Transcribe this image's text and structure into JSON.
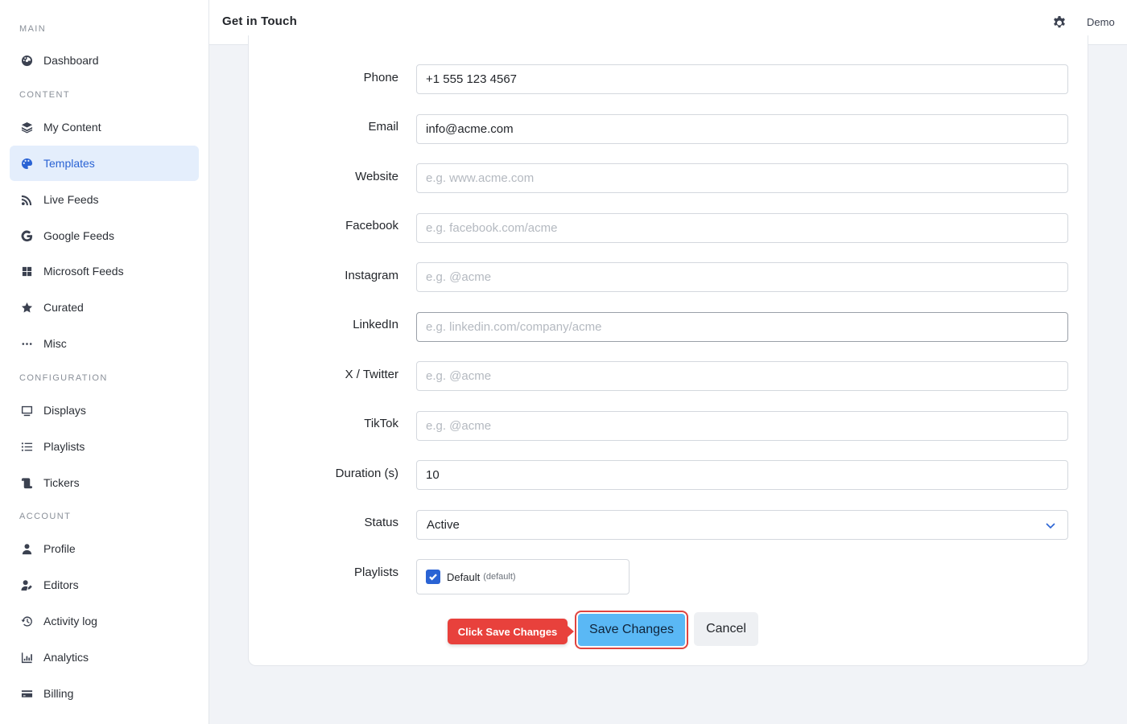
{
  "sidebar": {
    "sections": {
      "main": "MAIN",
      "content": "CONTENT",
      "configuration": "CONFIGURATION",
      "account": "ACCOUNT"
    },
    "items": {
      "dashboard": "Dashboard",
      "my_content": "My Content",
      "templates": "Templates",
      "live_feeds": "Live Feeds",
      "google_feeds": "Google Feeds",
      "microsoft_feeds": "Microsoft Feeds",
      "curated": "Curated",
      "misc": "Misc",
      "displays": "Displays",
      "playlists": "Playlists",
      "tickers": "Tickers",
      "profile": "Profile",
      "editors": "Editors",
      "activity_log": "Activity log",
      "analytics": "Analytics",
      "billing": "Billing"
    },
    "active_item": "Templates"
  },
  "header": {
    "title": "Get in Touch",
    "user": "Demo"
  },
  "form": {
    "phone": {
      "label": "Phone",
      "value": "+1 555 123 4567",
      "placeholder": ""
    },
    "email": {
      "label": "Email",
      "value": "info@acme.com",
      "placeholder": ""
    },
    "website": {
      "label": "Website",
      "value": "",
      "placeholder": "e.g. www.acme.com"
    },
    "facebook": {
      "label": "Facebook",
      "value": "",
      "placeholder": "e.g. facebook.com/acme"
    },
    "instagram": {
      "label": "Instagram",
      "value": "",
      "placeholder": "e.g. @acme"
    },
    "linkedin": {
      "label": "LinkedIn",
      "value": "",
      "placeholder": "e.g. linkedin.com/company/acme"
    },
    "twitter": {
      "label": "X / Twitter",
      "value": "",
      "placeholder": "e.g. @acme"
    },
    "tiktok": {
      "label": "TikTok",
      "value": "",
      "placeholder": "e.g. @acme"
    },
    "duration": {
      "label": "Duration (s)",
      "value": "10",
      "placeholder": ""
    },
    "status": {
      "label": "Status",
      "value": "Active"
    },
    "playlists": {
      "label": "Playlists",
      "items": [
        {
          "name": "Default",
          "tag": "(default)",
          "checked": true
        }
      ]
    },
    "save_label": "Save Changes",
    "cancel_label": "Cancel"
  },
  "tooltip": {
    "text": "Click Save Changes"
  },
  "colors": {
    "accent": "#2a63d4",
    "active_bg": "#e4eefc",
    "save_button": "#5ab8f5",
    "tooltip": "#e8413c"
  }
}
